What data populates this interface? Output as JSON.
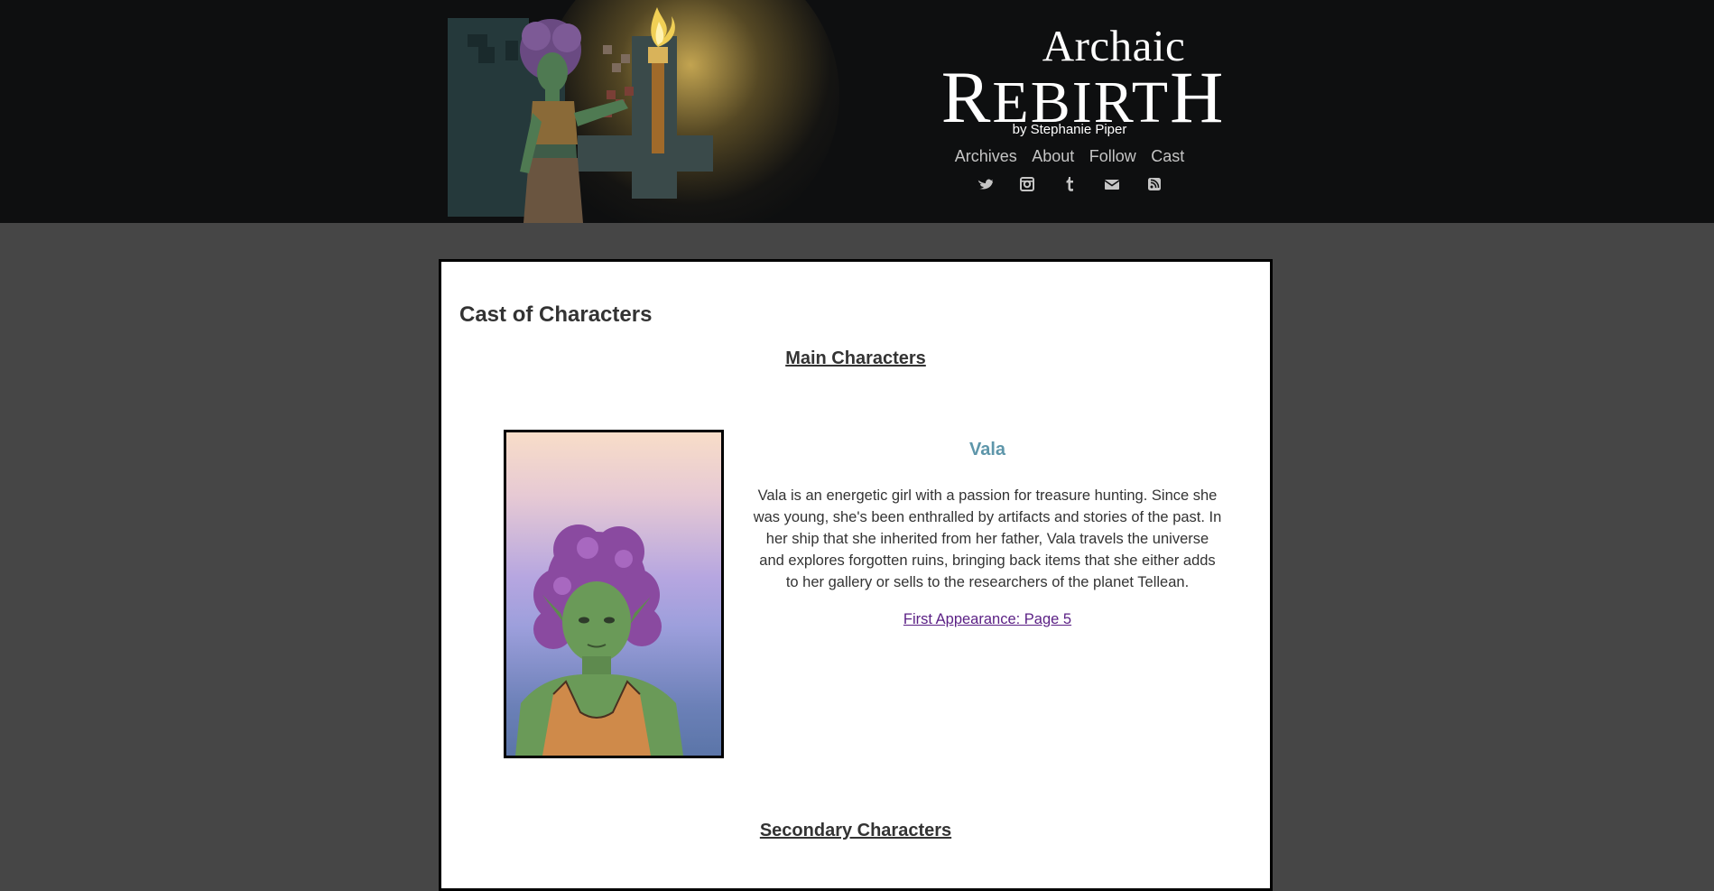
{
  "header": {
    "brand_top": "Archaic",
    "brand_main_letters": [
      "R",
      "EBIRT",
      "H"
    ],
    "byline": "by Stephanie Piper",
    "nav": [
      "Archives",
      "About",
      "Follow",
      "Cast"
    ],
    "social_icons": [
      "twitter-icon",
      "instagram-icon",
      "tumblr-icon",
      "email-icon",
      "rss-icon"
    ]
  },
  "content": {
    "page_title": "Cast of Characters",
    "main_heading": "Main Characters",
    "character": {
      "name": "Vala",
      "description": "Vala is an energetic girl with a passion for treasure hunting. Since she was young, she's been enthralled by artifacts and stories of the past. In her ship that she inherited from her father, Vala travels the universe and explores forgotten ruins, bringing back items that she either adds to her gallery or sells to the researchers of the planet Tellean.",
      "link": "First Appearance: Page 5"
    },
    "secondary_heading": "Secondary Characters"
  },
  "colors": {
    "page_background": "#464646",
    "header_background": "#0e0f10",
    "character_name": "#5e96aa",
    "link": "#5a1f84"
  }
}
